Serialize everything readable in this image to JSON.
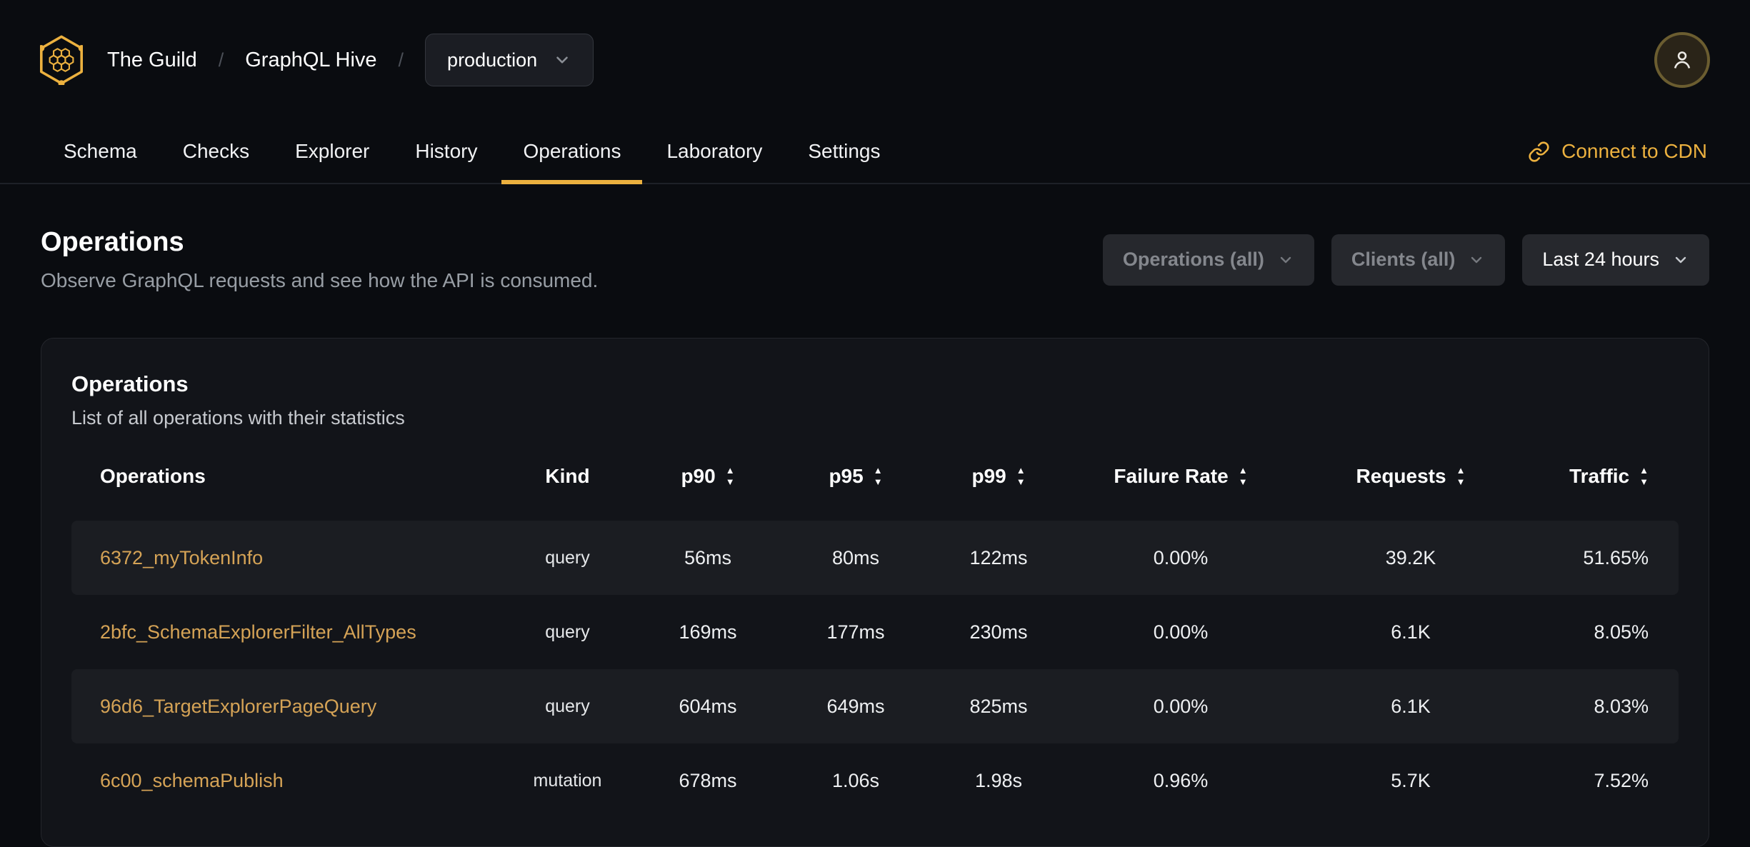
{
  "topbar": {
    "org": "The Guild",
    "separator": "/",
    "product": "GraphQL Hive",
    "env_selector": "production"
  },
  "nav": {
    "tabs": [
      {
        "label": "Schema",
        "active": false
      },
      {
        "label": "Checks",
        "active": false
      },
      {
        "label": "Explorer",
        "active": false
      },
      {
        "label": "History",
        "active": false
      },
      {
        "label": "Operations",
        "active": true
      },
      {
        "label": "Laboratory",
        "active": false
      },
      {
        "label": "Settings",
        "active": false
      }
    ],
    "cdn_link": "Connect to CDN"
  },
  "page_header": {
    "title": "Operations",
    "subtitle": "Observe GraphQL requests and see how the API is consumed."
  },
  "filters": {
    "operations": "Operations (all)",
    "clients": "Clients (all)",
    "period": "Last 24 hours"
  },
  "card": {
    "title": "Operations",
    "subtitle": "List of all operations with their statistics"
  },
  "table": {
    "columns": [
      {
        "label": "Operations",
        "sortable": false
      },
      {
        "label": "Kind",
        "sortable": false
      },
      {
        "label": "p90",
        "sortable": true
      },
      {
        "label": "p95",
        "sortable": true
      },
      {
        "label": "p99",
        "sortable": true
      },
      {
        "label": "Failure Rate",
        "sortable": true
      },
      {
        "label": "Requests",
        "sortable": true
      },
      {
        "label": "Traffic",
        "sortable": true
      }
    ],
    "rows": [
      {
        "name": "6372_myTokenInfo",
        "kind": "query",
        "p90": "56ms",
        "p95": "80ms",
        "p99": "122ms",
        "failure_rate": "0.00%",
        "requests": "39.2K",
        "traffic": "51.65%"
      },
      {
        "name": "2bfc_SchemaExplorerFilter_AllTypes",
        "kind": "query",
        "p90": "169ms",
        "p95": "177ms",
        "p99": "230ms",
        "failure_rate": "0.00%",
        "requests": "6.1K",
        "traffic": "8.05%"
      },
      {
        "name": "96d6_TargetExplorerPageQuery",
        "kind": "query",
        "p90": "604ms",
        "p95": "649ms",
        "p99": "825ms",
        "failure_rate": "0.00%",
        "requests": "6.1K",
        "traffic": "8.03%"
      },
      {
        "name": "6c00_schemaPublish",
        "kind": "mutation",
        "p90": "678ms",
        "p95": "1.06s",
        "p99": "1.98s",
        "failure_rate": "0.96%",
        "requests": "5.7K",
        "traffic": "7.52%"
      }
    ]
  },
  "icons": {
    "logo": "hive-hexagon-honeycomb",
    "env_chevron": "chevron-down",
    "cdn": "link-chain",
    "avatar": "user-person",
    "sort_asc": "▲",
    "sort_desc": "▼"
  },
  "colors": {
    "bg": "#0a0c10",
    "card": "#121419",
    "stripe": "#1b1d22",
    "accent": "#ecb13f",
    "link": "#d5a356"
  }
}
